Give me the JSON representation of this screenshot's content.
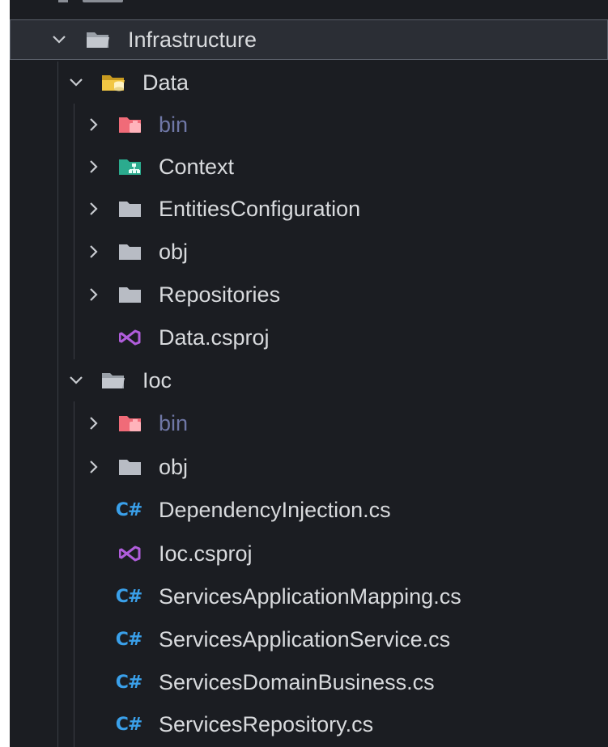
{
  "explorer": {
    "items": [
      {
        "label": "Infrastructure",
        "icon": "folder-open-icon",
        "expanded": true,
        "selected": true
      },
      {
        "label": "Data",
        "icon": "folder-database-open-icon",
        "expanded": true
      },
      {
        "label": "bin",
        "icon": "folder-bin-icon",
        "expanded": false,
        "dimmed": true
      },
      {
        "label": "Context",
        "icon": "folder-context-icon",
        "expanded": false
      },
      {
        "label": "EntitiesConfiguration",
        "icon": "folder-icon",
        "expanded": false
      },
      {
        "label": "obj",
        "icon": "folder-icon",
        "expanded": false
      },
      {
        "label": "Repositories",
        "icon": "folder-icon",
        "expanded": false
      },
      {
        "label": "Data.csproj",
        "icon": "visual-studio-project-icon"
      },
      {
        "label": "Ioc",
        "icon": "folder-open-icon",
        "expanded": true
      },
      {
        "label": "bin",
        "icon": "folder-bin-icon",
        "expanded": false,
        "dimmed": true
      },
      {
        "label": "obj",
        "icon": "folder-icon",
        "expanded": false
      },
      {
        "label": "DependencyInjection.cs",
        "icon": "csharp-file-icon"
      },
      {
        "label": "Ioc.csproj",
        "icon": "visual-studio-project-icon"
      },
      {
        "label": "ServicesApplicationMapping.cs",
        "icon": "csharp-file-icon"
      },
      {
        "label": "ServicesApplicationService.cs",
        "icon": "csharp-file-icon"
      },
      {
        "label": "ServicesDomainBusiness.cs",
        "icon": "csharp-file-icon"
      },
      {
        "label": "ServicesRepository.cs",
        "icon": "csharp-file-icon"
      }
    ],
    "csharp_glyph": "C#",
    "colors": {
      "background": "#1b1d22",
      "selected_row": "#2b2e35",
      "text": "#d8dadd",
      "dimmed_text": "#6f77a6",
      "csharp": "#3aa0ea",
      "vs_project": "#b05ddb",
      "folder": "#b8bcc4",
      "folder_bin": "#f06b78",
      "folder_data": "#f2c744",
      "folder_context": "#2bab8e"
    }
  }
}
